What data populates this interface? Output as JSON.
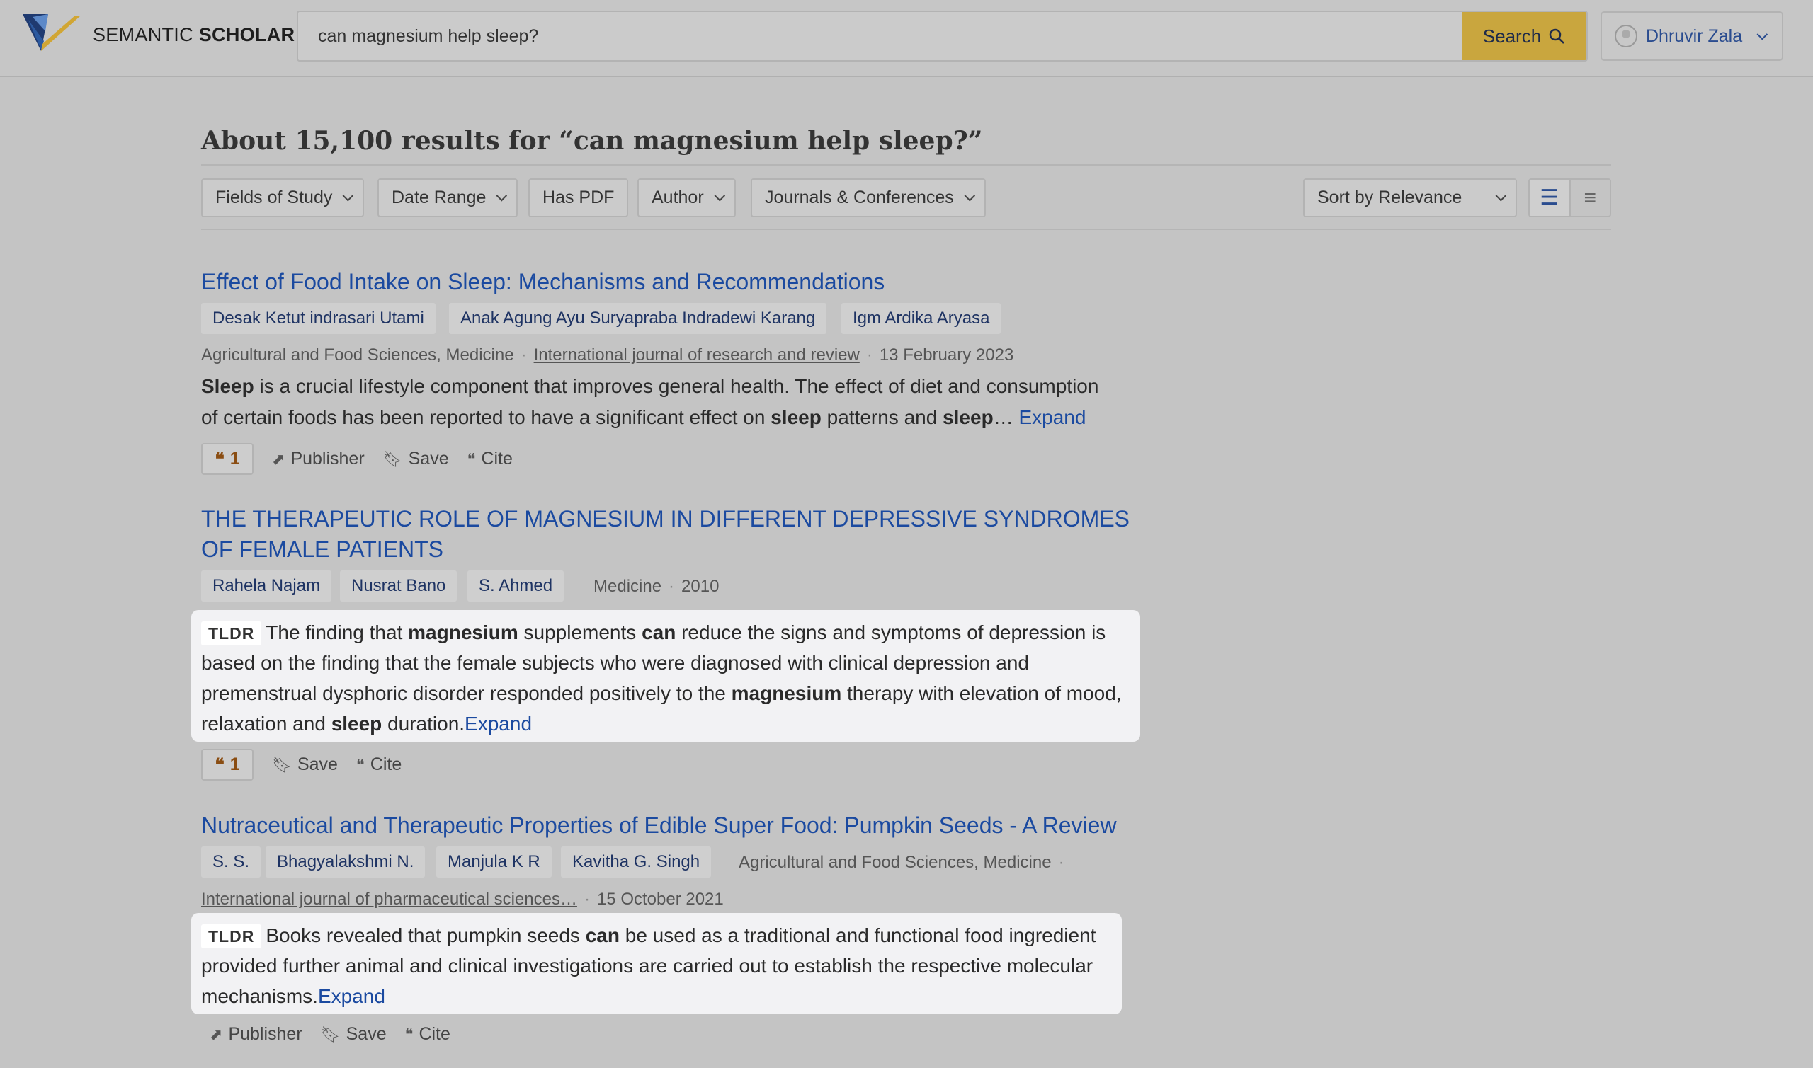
{
  "app": {
    "logo_prefix": "SEMANTIC",
    "logo_suffix": "SCHOLAR"
  },
  "search": {
    "value": "can magnesium help sleep?",
    "button_label": "Search"
  },
  "user": {
    "name": "Dhruvir Zala"
  },
  "results_heading": "About 15,100 results for “can magnesium help sleep?”",
  "filters": {
    "fields_of_study": "Fields of Study",
    "date_range": "Date Range",
    "has_pdf": "Has PDF",
    "author": "Author",
    "journals": "Journals & Conferences",
    "sort": "Sort by Relevance"
  },
  "results": [
    {
      "title": "Effect of Food Intake on Sleep: Mechanisms and Recommendations",
      "authors": [
        "Desak Ketut indrasari Utami",
        "Anak Agung Ayu Suryapraba Indradewi Karang",
        "Igm Ardika Aryasa"
      ],
      "fields": "Agricultural and Food Sciences, Medicine",
      "venue": "International journal of research and review",
      "date": "13 February 2023",
      "abstract_line1_a": "Sleep",
      "abstract_line1_b": " is a crucial lifestyle component that improves general health. The effect of diet and consumption",
      "abstract_line2_a": "of certain foods has been reported to have a significant effect on ",
      "abstract_line2_b": "sleep",
      "abstract_line2_c": " patterns and ",
      "abstract_line2_d": "sleep",
      "abstract_line2_e": "… ",
      "expand": "Expand",
      "citations": "1",
      "publisher": "Publisher",
      "save": "Save",
      "cite": "Cite"
    },
    {
      "title": "THE THERAPEUTIC ROLE OF MAGNESIUM IN DIFFERENT DEPRESSIVE SYNDROMES OF FEMALE PATIENTS",
      "authors": [
        "Rahela Najam",
        "Nusrat Bano",
        "S. Ahmed"
      ],
      "fields": "Medicine",
      "date": "2010",
      "tldr_label": "TLDR",
      "tldr_1": "The finding that ",
      "tldr_2": "magnesium",
      "tldr_3": " supplements ",
      "tldr_4": "can",
      "tldr_5": " reduce the signs and symptoms of depression is based on the finding that the female subjects who were diagnosed with clinical depression and premenstrual dysphoric disorder responded positively to the ",
      "tldr_6": "magnesium",
      "tldr_7": " therapy with elevation of mood, relaxation and ",
      "tldr_8": "sleep",
      "tldr_9": " duration.",
      "expand": "Expand",
      "citations": "1",
      "save": "Save",
      "cite": "Cite"
    },
    {
      "title": "Nutraceutical and Therapeutic Properties of Edible Super Food: Pumpkin Seeds - A Review",
      "authors": [
        "S. S.",
        "Bhagyalakshmi N.",
        "Manjula K R",
        "Kavitha G. Singh"
      ],
      "fields": "Agricultural and Food Sciences, Medicine",
      "venue": "International journal of pharmaceutical sciences…",
      "date": "15 October 2021",
      "tldr_label": "TLDR",
      "tldr_1": "Books revealed that pumpkin seeds ",
      "tldr_2": "can",
      "tldr_3": " be used as a traditional and functional food ingredient provided further animal and clinical investigations are carried out to establish the respective molecular mechanisms.",
      "expand": "Expand",
      "publisher": "Publisher",
      "save": "Save",
      "cite": "Cite"
    }
  ],
  "icons": {
    "search": "search-icon",
    "chevron": "chevron-down-icon",
    "list_view": "list-view-icon",
    "compact_view": "compact-view-icon",
    "quote": "quote-icon",
    "bookmark": "bookmark-icon",
    "external": "external-link-icon"
  },
  "colors": {
    "brand_gold": "#c9a63e",
    "link_blue": "#1b4aa0",
    "citation_brown": "#8a4d12"
  }
}
